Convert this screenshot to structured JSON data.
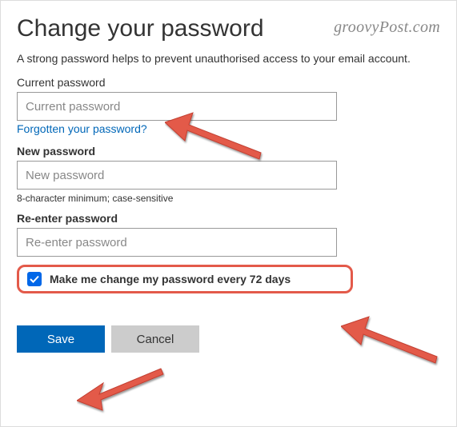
{
  "watermark": "groovyPost.com",
  "title": "Change your password",
  "subtitle": "A strong password helps to prevent unauthorised access to your email account.",
  "current": {
    "label": "Current password",
    "placeholder": "Current password",
    "forgot_link": "Forgotten your password?"
  },
  "new": {
    "label": "New password",
    "placeholder": "New password",
    "hint": "8-character minimum; case-sensitive"
  },
  "reenter": {
    "label": "Re-enter password",
    "placeholder": "Re-enter password"
  },
  "checkbox": {
    "checked": true,
    "label": "Make me change my password every 72 days"
  },
  "buttons": {
    "save": "Save",
    "cancel": "Cancel"
  }
}
